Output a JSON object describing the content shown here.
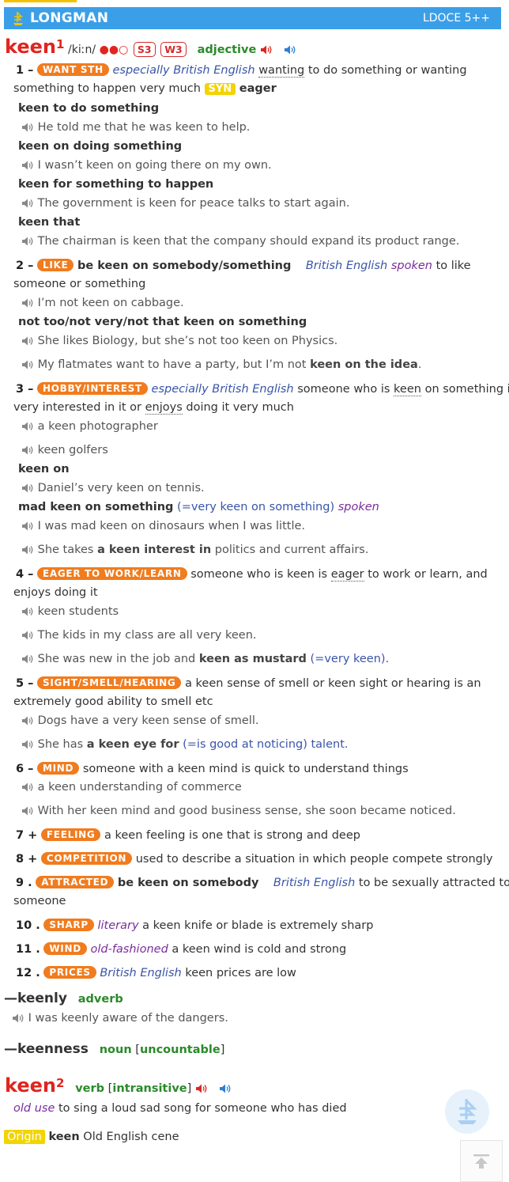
{
  "app": {
    "brand": "LONGMAN",
    "edition": "LDOCE 5++"
  },
  "entry1": {
    "headword": "keen",
    "hom": "1",
    "pron": "/kiːn/",
    "freq": "●●○",
    "badges": [
      "S3",
      "W3"
    ],
    "pos": "adjective"
  },
  "s1": {
    "num": "1 –",
    "signpost": "WANT STH",
    "reg": "especially British English",
    "def_a": "to do something or wanting",
    "def_b": "something to happen very much",
    "syn_label": "SYN",
    "syn": "eager",
    "c1": "keen to do something",
    "e1": "He told me that he was keen to help.",
    "c2": "keen on doing something",
    "e2": "I wasn’t keen on going there on my own.",
    "c3": "keen for something to happen",
    "e3": "The government is keen for peace talks to start again.",
    "c4": "keen that",
    "e4": "The chairman is keen that the company should expand its product range."
  },
  "s2": {
    "num": "2 –",
    "signpost": "LIKE",
    "lex": "be keen on somebody/something",
    "reg": "British English",
    "spoken": "spoken",
    "def_a": "to like",
    "def_b": "someone or something",
    "e1": "I’m not keen on cabbage.",
    "c1": "not too/not very/not that keen on something",
    "e2": "She likes Biology, but she’s not too keen on Physics.",
    "e3a": "My flatmates want to have a party, but I’m not ",
    "e3b": "keen on the idea",
    "e3c": "."
  },
  "s3": {
    "num": "3 –",
    "signpost": "HOBBY/INTEREST",
    "reg": "especially British English",
    "def_a": "someone who is",
    "def_a2": "keen",
    "def_a3": "on something is",
    "def_b": "very interested in it or",
    "def_b2": "enjoys",
    "def_b3": "doing it very much",
    "e1": "a keen photographer",
    "e2": "keen golfers",
    "c1": "keen on",
    "e3": "Daniel’s very keen on tennis.",
    "c2": "mad keen on something",
    "g2": "(=very keen on something)",
    "spoken": "spoken",
    "e4": "I was mad keen on dinosaurs when I was little.",
    "e5a": "She takes ",
    "e5b": "a keen interest in",
    "e5c": " politics and current affairs."
  },
  "s4": {
    "num": "4 –",
    "signpost": "EAGER TO WORK/LEARN",
    "def_a": "someone who is keen is",
    "def_a2": "eager",
    "def_a3": "to work or learn, and",
    "def_b": "enjoys doing it",
    "e1": "keen students",
    "e2": "The kids in my class are all very keen.",
    "e3a": "She was new in the job and ",
    "e3b": "keen as mustard",
    "e3c": " (=very keen)."
  },
  "s5": {
    "num": "5 –",
    "signpost": "SIGHT/SMELL/HEARING",
    "def_a": "a keen sense of smell or keen sight or hearing is an",
    "def_b": "extremely good ability to smell etc",
    "e1": "Dogs have a very keen sense of smell.",
    "e2a": "She has ",
    "e2b": "a keen eye for",
    "e2c": " (=is good at noticing) talent."
  },
  "s6": {
    "num": "6 –",
    "signpost": "MIND",
    "def": "someone with a keen mind is quick to understand things",
    "e1": "a keen understanding of commerce",
    "e2": "With her keen mind and good business sense, she soon became noticed."
  },
  "s7": {
    "num": "7 +",
    "signpost": "FEELING",
    "def": "a keen feeling is one that is strong and deep"
  },
  "s8": {
    "num": "8 +",
    "signpost": "COMPETITION",
    "def": "used to describe a situation in which people compete strongly"
  },
  "s9": {
    "num": "9 .",
    "signpost": "ATTRACTED",
    "lex": "be keen on somebody",
    "reg": "British English",
    "def_a": "to be sexually attracted to",
    "def_b": "someone"
  },
  "s10": {
    "num": "10 .",
    "signpost": "SHARP",
    "reg": "literary",
    "def": "a keen knife or blade is extremely sharp"
  },
  "s11": {
    "num": "11 .",
    "signpost": "WIND",
    "reg": "old-fashioned",
    "def": "a keen wind is cold and strong"
  },
  "s12": {
    "num": "12 .",
    "signpost": "PRICES",
    "reg": "British English",
    "def": "keen prices are low"
  },
  "runon1": {
    "dash": "—",
    "word": "keenly",
    "pos": "adverb",
    "ex": "I was keenly aware of the dangers."
  },
  "runon2": {
    "dash": "—",
    "word": "keenness",
    "pos": "noun",
    "gram": "uncountable"
  },
  "entry2": {
    "headword": "keen",
    "hom": "2",
    "pos": "verb",
    "gram": "intransitive",
    "reg": "old use",
    "def": "to sing a loud sad song for someone who has died"
  },
  "origin": {
    "label": "Origin",
    "word": "keen",
    "text": "Old English cene"
  },
  "colors": {
    "brand": "#3b9fe8",
    "headword": "#e0251f",
    "signpost": "#f07c1f",
    "pos": "#2a8a2a",
    "syn": "#f2d400"
  }
}
